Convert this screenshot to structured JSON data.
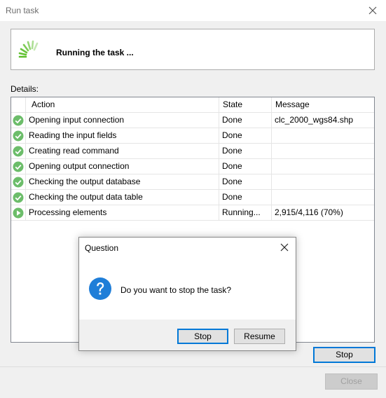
{
  "window": {
    "title": "Run task"
  },
  "banner": {
    "text": "Running the task ..."
  },
  "details_label": "Details:",
  "table": {
    "columns": [
      "Action",
      "State",
      "Message"
    ],
    "rows": [
      {
        "status": "done",
        "action": "Opening input connection",
        "state": "Done",
        "message": "clc_2000_wgs84.shp"
      },
      {
        "status": "done",
        "action": "Reading the input fields",
        "state": "Done",
        "message": ""
      },
      {
        "status": "done",
        "action": "Creating read command",
        "state": "Done",
        "message": ""
      },
      {
        "status": "done",
        "action": "Opening output connection",
        "state": "Done",
        "message": ""
      },
      {
        "status": "done",
        "action": "Checking the output database",
        "state": "Done",
        "message": ""
      },
      {
        "status": "done",
        "action": "Checking the output data table",
        "state": "Done",
        "message": ""
      },
      {
        "status": "running",
        "action": "Processing elements",
        "state": "Running...",
        "message": "2,915/4,116 (70%)"
      }
    ]
  },
  "buttons": {
    "stop": "Stop",
    "close": "Close"
  },
  "dialog": {
    "title": "Question",
    "message": "Do you want to stop the task?",
    "stop": "Stop",
    "resume": "Resume"
  },
  "colors": {
    "done_green": "#6cbd6a",
    "question_blue": "#1f7ed8",
    "focus_blue": "#0078d7"
  }
}
